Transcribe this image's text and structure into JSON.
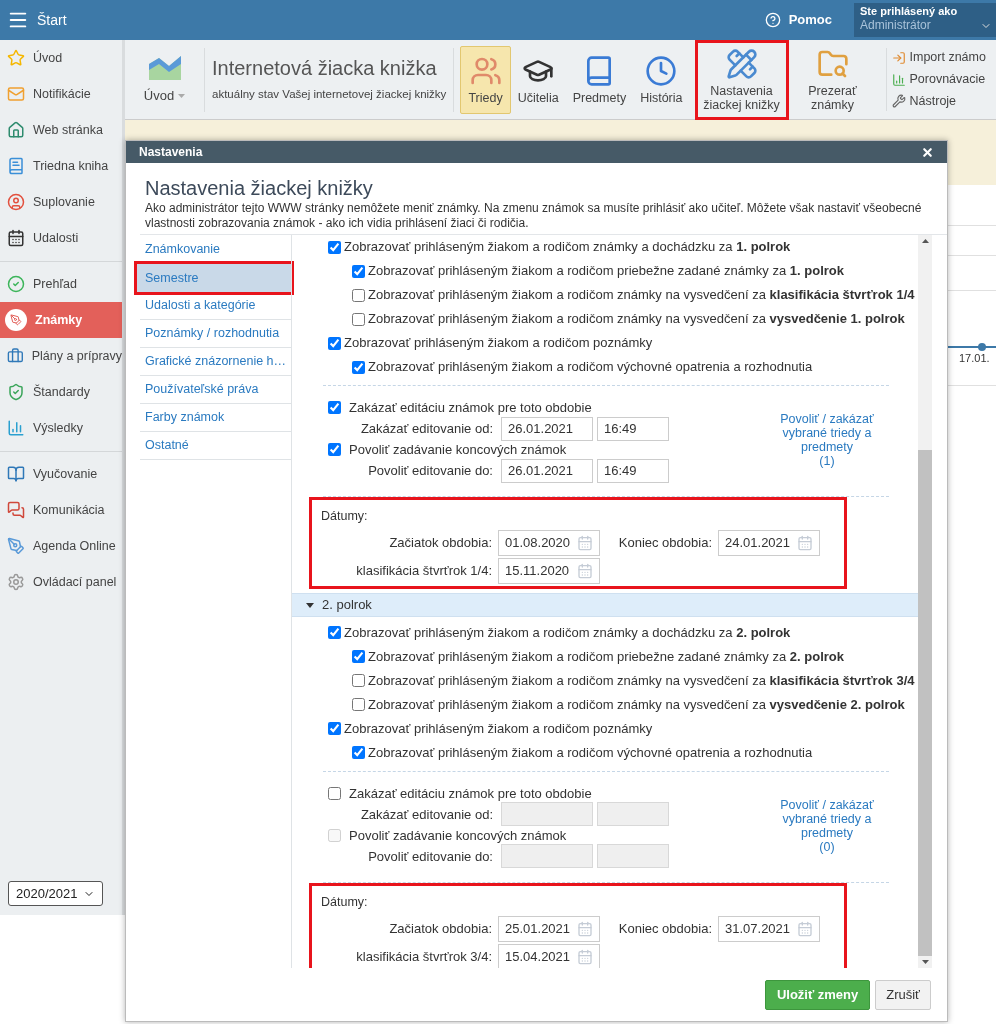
{
  "topbar": {
    "title": "Štart",
    "help": "Pomoc",
    "user_caption": "Ste prihlásený ako",
    "user_name": "Administrátor"
  },
  "sidebar": {
    "groups": [
      [
        {
          "label": "Úvod",
          "selected": false
        },
        {
          "label": "Notifikácie",
          "selected": false
        },
        {
          "label": "Web stránka",
          "selected": false
        },
        {
          "label": "Triedna kniha",
          "selected": false
        },
        {
          "label": "Suplovanie",
          "selected": false
        },
        {
          "label": "Udalosti",
          "selected": false
        }
      ],
      [
        {
          "label": "Prehľad",
          "selected": false
        },
        {
          "label": "Známky",
          "selected": true
        },
        {
          "label": "Plány a prípravy",
          "selected": false
        },
        {
          "label": "Štandardy",
          "selected": false
        },
        {
          "label": "Výsledky",
          "selected": false
        }
      ],
      [
        {
          "label": "Vyučovanie",
          "selected": false
        },
        {
          "label": "Komunikácia",
          "selected": false
        },
        {
          "label": "Agenda Online",
          "selected": false
        },
        {
          "label": "Ovládací panel",
          "selected": false
        }
      ]
    ],
    "year": "2020/2021"
  },
  "toolbar": {
    "home": "Úvod",
    "title": "Internetová žiacka knižka",
    "subtitle": "aktuálny stav Vašej internetovej žiackej knižky",
    "buttons": [
      {
        "label": "Triedy",
        "selected": true,
        "highlighted": false
      },
      {
        "label": "Učitelia",
        "selected": false,
        "highlighted": false
      },
      {
        "label": "Predmety",
        "selected": false,
        "highlighted": false
      },
      {
        "label": "História",
        "selected": false,
        "highlighted": false
      },
      {
        "label": "Nastavenia žiackej knižky",
        "selected": false,
        "highlighted": true
      },
      {
        "label": "Prezerať známky",
        "selected": false,
        "highlighted": false
      }
    ],
    "small_items": [
      "Import známo",
      "Porovnávacie",
      "Nástroje"
    ]
  },
  "background": {
    "timeline_label": "17.01."
  },
  "dialog": {
    "title": "Nastavenia",
    "heading": "Nastavenia žiackej knižky",
    "description": "Ako administrátor tejto WWW stránky nemôžete meniť známky. Na zmenu známok sa musíte prihlásiť ako učiteľ. Môžete však nastaviť všeobecné vlastnosti zobrazovania známok - ako ich vidia prihlásení žiaci či rodičia.",
    "nav": [
      {
        "label": "Známkovanie",
        "selected": false,
        "highlighted": false
      },
      {
        "label": "Semestre",
        "selected": true,
        "highlighted": true
      },
      {
        "label": "Udalosti a kategórie",
        "selected": false,
        "highlighted": false
      },
      {
        "label": "Poznámky / rozhodnutia",
        "selected": false,
        "highlighted": false
      },
      {
        "label": "Grafické znázornenie h…",
        "selected": false,
        "highlighted": false
      },
      {
        "label": "Používateľské práva",
        "selected": false,
        "highlighted": false
      },
      {
        "label": "Farby známok",
        "selected": false,
        "highlighted": false
      },
      {
        "label": "Ostatné",
        "selected": false,
        "highlighted": false
      }
    ],
    "periods": [
      {
        "checks": [
          {
            "label": "Zobrazovať prihláseným žiakom a rodičom známky a dochádzku za **1. polrok**",
            "checked": true,
            "children": [
              {
                "label": "Zobrazovať prihláseným žiakom a rodičom priebežne zadané známky za **1. polrok**",
                "checked": true
              },
              {
                "label": "Zobrazovať prihláseným žiakom a rodičom známky na vysvedčení za **klasifikácia štvrťrok 1/4**",
                "checked": false
              },
              {
                "label": "Zobrazovať prihláseným žiakom a rodičom známky na vysvedčení za **vysvedčenie 1. polrok**",
                "checked": false
              }
            ]
          },
          {
            "label": "Zobrazovať prihláseným žiakom a rodičom poznámky",
            "checked": true,
            "children": [
              {
                "label": "Zobrazovať prihláseným žiakom a rodičom výchovné opatrenia a rozhodnutia",
                "checked": true
              }
            ]
          }
        ],
        "lock": {
          "rows": [
            {
              "kind": "check",
              "label": "Zakázať editáciu známok pre toto obdobie",
              "checked": true,
              "disabled": false
            },
            {
              "kind": "fields",
              "label": "Zakázať editovanie od:",
              "date": "26.01.2021",
              "time": "16:49",
              "disabled": false
            },
            {
              "kind": "check",
              "label": "Povoliť zadávanie koncových známok",
              "checked": true,
              "disabled": false
            },
            {
              "kind": "fields",
              "label": "Povoliť editovanie do:",
              "date": "26.01.2021",
              "time": "16:49",
              "disabled": false
            }
          ],
          "link": "Povoliť / zakázať vybrané triedy a predmety",
          "count": "(1)"
        },
        "dates": {
          "label": "Dátumy:",
          "highlighted": true,
          "start_label": "Začiatok obdobia:",
          "start": "01.08.2020",
          "end_label": "Koniec obdobia:",
          "end": "24.01.2021",
          "quarter_label": "klasifikácia štvrťrok 1/4:",
          "quarter": "15.11.2020"
        }
      },
      {
        "header": {
          "label": "2. polrok",
          "expanded": true
        },
        "checks": [
          {
            "label": "Zobrazovať prihláseným žiakom a rodičom známky a dochádzku za **2. polrok**",
            "checked": true,
            "children": [
              {
                "label": "Zobrazovať prihláseným žiakom a rodičom priebežne zadané známky za **2. polrok**",
                "checked": true
              },
              {
                "label": "Zobrazovať prihláseným žiakom a rodičom známky na vysvedčení za **klasifikácia štvrťrok 3/4**",
                "checked": false
              },
              {
                "label": "Zobrazovať prihláseným žiakom a rodičom známky na vysvedčení za **vysvedčenie 2. polrok**",
                "checked": false
              }
            ]
          },
          {
            "label": "Zobrazovať prihláseným žiakom a rodičom poznámky",
            "checked": true,
            "children": [
              {
                "label": "Zobrazovať prihláseným žiakom a rodičom výchovné opatrenia a rozhodnutia",
                "checked": true
              }
            ]
          }
        ],
        "lock": {
          "rows": [
            {
              "kind": "check",
              "label": "Zakázať editáciu známok pre toto obdobie",
              "checked": false,
              "disabled": false
            },
            {
              "kind": "fields",
              "label": "Zakázať editovanie od:",
              "disabled": true
            },
            {
              "kind": "check",
              "label": "Povoliť zadávanie koncových známok",
              "checked": false,
              "disabled": true
            },
            {
              "kind": "fields",
              "label": "Povoliť editovanie do:",
              "disabled": true
            }
          ],
          "link": "Povoliť / zakázať vybrané triedy a predmety",
          "count": "(0)"
        },
        "dates": {
          "label": "Dátumy:",
          "highlighted": true,
          "start_label": "Začiatok obdobia:",
          "start": "25.01.2021",
          "end_label": "Koniec obdobia:",
          "end": "31.07.2021",
          "quarter_label": "klasifikácia štvrťrok 3/4:",
          "quarter": "15.04.2021"
        }
      }
    ],
    "buttons": {
      "save": "Uložiť zmeny",
      "cancel": "Zrušiť"
    }
  }
}
